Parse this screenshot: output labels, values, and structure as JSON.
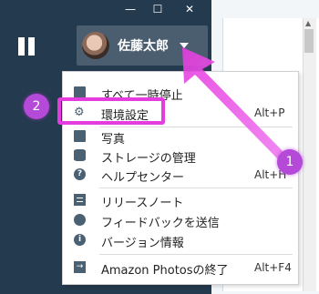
{
  "window": {
    "min_glyph": "—",
    "max_glyph": "☐",
    "close_glyph": "✕"
  },
  "header": {
    "user_name": "佐藤太郎"
  },
  "menu": {
    "items": [
      {
        "label": "すべて一時停止",
        "shortcut": "",
        "icon": "pause-icon"
      },
      {
        "label": "環境設定",
        "shortcut": "Alt+P",
        "icon": "gear-icon"
      },
      {
        "label": "写真",
        "shortcut": "",
        "icon": "photo-icon"
      },
      {
        "label": "ストレージの管理",
        "shortcut": "",
        "icon": "storage-icon"
      },
      {
        "label": "ヘルプセンター",
        "shortcut": "Alt+H",
        "icon": "help-icon"
      },
      {
        "label": "リリースノート",
        "shortcut": "",
        "icon": "list-icon"
      },
      {
        "label": "フィードバックを送信",
        "shortcut": "",
        "icon": "chat-icon"
      },
      {
        "label": "バージョン情報",
        "shortcut": "",
        "icon": "info-icon"
      },
      {
        "label": "Amazon Photosの終了",
        "shortcut": "Alt+F4",
        "icon": "exit-icon"
      }
    ]
  },
  "annotations": {
    "badge_1": "1",
    "badge_2": "2",
    "accent_color": "#e53ce0",
    "badge_color": "#b54ad8"
  }
}
